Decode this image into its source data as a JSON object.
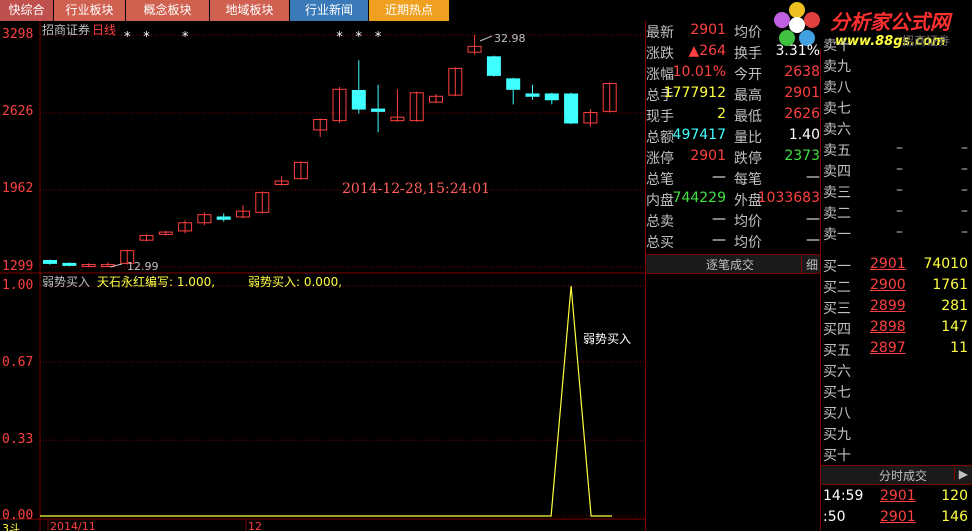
{
  "tabs": [
    {
      "label": "快综合",
      "bg": "#c0504d"
    },
    {
      "label": "行业板块",
      "bg": "#d06050"
    },
    {
      "label": "概念板块",
      "bg": "#d06050"
    },
    {
      "label": "地域板块",
      "bg": "#d06050"
    },
    {
      "label": "行业新闻",
      "bg": "#3a7ab8"
    },
    {
      "label": "近期热点",
      "bg": "#f0a020"
    }
  ],
  "logo": {
    "title": "分析家公式网",
    "url": "www.88gs.com",
    "ghost": "招商证券"
  },
  "chart": {
    "stock_name": "招商证券",
    "period": "日线",
    "timestamp": "2014-12-28,15:24:01",
    "high_label": "32.98",
    "low_label": "12.99",
    "y_ticks": [
      "3298",
      "2626",
      "1962",
      "1299"
    ],
    "date_ticks": [
      "2014/11",
      "12"
    ],
    "indicator_title": "弱势买入",
    "indicator_author": "天石永红编写: 1.000,",
    "indicator_value": "弱势买入: 0.000,",
    "indicator_y_ticks": [
      "1.00",
      "0.67",
      "0.33",
      "0.00"
    ],
    "indicator_peak_label": "弱势买入",
    "status_text": "3斗"
  },
  "chart_data": {
    "type": "candlestick",
    "ylim": [
      1299,
      3298
    ],
    "candles": [
      {
        "o": 1330,
        "c": 1355,
        "h": 1365,
        "l": 1320,
        "up": false
      },
      {
        "o": 1315,
        "c": 1330,
        "h": 1340,
        "l": 1305,
        "up": false
      },
      {
        "o": 1310,
        "c": 1320,
        "h": 1330,
        "l": 1300,
        "up": true
      },
      {
        "o": 1320,
        "c": 1310,
        "h": 1340,
        "l": 1299,
        "up": true
      },
      {
        "o": 1330,
        "c": 1440,
        "h": 1450,
        "l": 1320,
        "up": true
      },
      {
        "o": 1530,
        "c": 1570,
        "h": 1580,
        "l": 1520,
        "up": true
      },
      {
        "o": 1580,
        "c": 1600,
        "h": 1610,
        "l": 1570,
        "up": true
      },
      {
        "o": 1610,
        "c": 1680,
        "h": 1700,
        "l": 1590,
        "up": true
      },
      {
        "o": 1680,
        "c": 1750,
        "h": 1770,
        "l": 1660,
        "up": true
      },
      {
        "o": 1730,
        "c": 1710,
        "h": 1760,
        "l": 1690,
        "up": false
      },
      {
        "o": 1730,
        "c": 1780,
        "h": 1830,
        "l": 1720,
        "up": true
      },
      {
        "o": 1770,
        "c": 1940,
        "h": 1950,
        "l": 1760,
        "up": true
      },
      {
        "o": 2010,
        "c": 2040,
        "h": 2080,
        "l": 2000,
        "up": true
      },
      {
        "o": 2060,
        "c": 2200,
        "h": 2210,
        "l": 2050,
        "up": true
      },
      {
        "o": 2480,
        "c": 2570,
        "h": 2580,
        "l": 2420,
        "up": true
      },
      {
        "o": 2560,
        "c": 2830,
        "h": 2850,
        "l": 2540,
        "up": true
      },
      {
        "o": 2820,
        "c": 2660,
        "h": 3080,
        "l": 2620,
        "up": false
      },
      {
        "o": 2660,
        "c": 2640,
        "h": 2870,
        "l": 2460,
        "up": false
      },
      {
        "o": 2560,
        "c": 2590,
        "h": 2830,
        "l": 2550,
        "up": true
      },
      {
        "o": 2560,
        "c": 2800,
        "h": 2810,
        "l": 2550,
        "up": true
      },
      {
        "o": 2720,
        "c": 2770,
        "h": 2790,
        "l": 2710,
        "up": true
      },
      {
        "o": 2780,
        "c": 3010,
        "h": 3020,
        "l": 2770,
        "up": true
      },
      {
        "o": 3150,
        "c": 3200,
        "h": 3298,
        "l": 3130,
        "up": true
      },
      {
        "o": 3110,
        "c": 2950,
        "h": 3120,
        "l": 2940,
        "up": false
      },
      {
        "o": 2920,
        "c": 2830,
        "h": 2930,
        "l": 2700,
        "up": false
      },
      {
        "o": 2790,
        "c": 2770,
        "h": 2870,
        "l": 2740,
        "up": false
      },
      {
        "o": 2790,
        "c": 2740,
        "h": 2800,
        "l": 2700,
        "up": false
      },
      {
        "o": 2790,
        "c": 2540,
        "h": 2800,
        "l": 2530,
        "up": false
      },
      {
        "o": 2540,
        "c": 2630,
        "h": 2660,
        "l": 2510,
        "up": true
      },
      {
        "o": 2640,
        "c": 2880,
        "h": 2890,
        "l": 2630,
        "up": true
      }
    ],
    "star_marks": [
      4,
      5,
      7,
      15,
      16,
      17
    ],
    "indicator": {
      "ylim": [
        0,
        1
      ],
      "peak_index": 27,
      "values_note": "0 everywhere except 1.0 at peak"
    }
  },
  "quote": {
    "rows": [
      {
        "l1": "最新",
        "v1": "2901",
        "c1": "red",
        "l2": "均价",
        "v2": "",
        "c2": "red"
      },
      {
        "l1": "涨跌",
        "v1": "▲264",
        "c1": "red",
        "l2": "换手",
        "v2": "3.31%",
        "c2": "white"
      },
      {
        "l1": "涨幅",
        "v1": "10.01%",
        "c1": "red",
        "l2": "今开",
        "v2": "2638",
        "c2": "red"
      },
      {
        "l1": "总手",
        "v1": "1777912",
        "c1": "yellow",
        "l2": "最高",
        "v2": "2901",
        "c2": "red"
      },
      {
        "l1": "现手",
        "v1": "2",
        "c1": "yellow",
        "l2": "最低",
        "v2": "2626",
        "c2": "red"
      },
      {
        "l1": "总额",
        "v1": "497417",
        "c1": "cyan",
        "l2": "量比",
        "v2": "1.40",
        "c2": "white"
      },
      {
        "l1": "涨停",
        "v1": "2901",
        "c1": "red",
        "l2": "跌停",
        "v2": "2373",
        "c2": "green"
      },
      {
        "l1": "总笔",
        "v1": "—",
        "c1": "white",
        "l2": "每笔",
        "v2": "—",
        "c2": "white"
      },
      {
        "l1": "内盘",
        "v1": "744229",
        "c1": "green",
        "l2": "外盘",
        "v2": "1033683",
        "c2": "red"
      },
      {
        "l1": "总卖",
        "v1": "—",
        "c1": "white",
        "l2": "均价",
        "v2": "—",
        "c2": "white"
      },
      {
        "l1": "总买",
        "v1": "—",
        "c1": "white",
        "l2": "均价",
        "v2": "—",
        "c2": "white"
      }
    ],
    "trade_header": "逐笔成交",
    "trade_detail": "细"
  },
  "orderbook": {
    "sells": [
      {
        "label": "卖十",
        "price": "",
        "vol": ""
      },
      {
        "label": "卖九",
        "price": "",
        "vol": ""
      },
      {
        "label": "卖八",
        "price": "",
        "vol": ""
      },
      {
        "label": "卖七",
        "price": "",
        "vol": ""
      },
      {
        "label": "卖六",
        "price": "",
        "vol": ""
      },
      {
        "label": "卖五",
        "price": "–",
        "vol": "–"
      },
      {
        "label": "卖四",
        "price": "–",
        "vol": "–"
      },
      {
        "label": "卖三",
        "price": "–",
        "vol": "–"
      },
      {
        "label": "卖二",
        "price": "–",
        "vol": "–"
      },
      {
        "label": "卖一",
        "price": "–",
        "vol": "–"
      }
    ],
    "buys": [
      {
        "label": "买一",
        "price": "2901",
        "vol": "74010"
      },
      {
        "label": "买二",
        "price": "2900",
        "vol": "1761"
      },
      {
        "label": "买三",
        "price": "2899",
        "vol": "281"
      },
      {
        "label": "买四",
        "price": "2898",
        "vol": "147"
      },
      {
        "label": "买五",
        "price": "2897",
        "vol": "11"
      },
      {
        "label": "买六",
        "price": "",
        "vol": ""
      },
      {
        "label": "买七",
        "price": "",
        "vol": ""
      },
      {
        "label": "买八",
        "price": "",
        "vol": ""
      },
      {
        "label": "买九",
        "price": "",
        "vol": ""
      },
      {
        "label": "买十",
        "price": "",
        "vol": ""
      }
    ],
    "tick_header": "分时成交",
    "tick_scroll": "▶",
    "ticks": [
      {
        "time": "14:59",
        "price": "2901",
        "vol": "120"
      },
      {
        "time": ":50",
        "price": "2901",
        "vol": "146"
      }
    ]
  },
  "colors": {
    "up": "#ff4040",
    "down": "#40ffff",
    "grid": "#800000",
    "indicator_line": "#ffff40"
  }
}
